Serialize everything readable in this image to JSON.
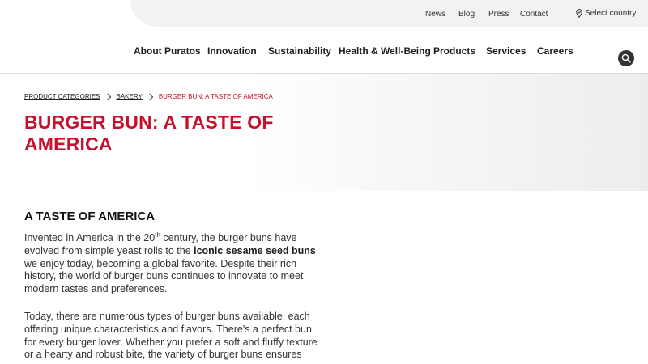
{
  "utility_nav": {
    "news": "News",
    "blog": "Blog",
    "press": "Press",
    "contact": "Contact",
    "country": "Select country",
    "country_icon": "location-pin-icon"
  },
  "main_nav": {
    "items": [
      "About Puratos",
      "Innovation",
      "Sustainability",
      "Health & Well-Being",
      "Products",
      "Services",
      "Careers"
    ],
    "search_icon": "search-icon"
  },
  "breadcrumb": {
    "items": [
      "PRODUCT CATEGORIES",
      "BAKERY"
    ],
    "current": "BURGER BUN: A TASTE OF AMERICA"
  },
  "page": {
    "title": "BURGER BUN: A TASTE OF AMERICA"
  },
  "content": {
    "section_title": "A TASTE OF AMERICA",
    "p1_a": "Invented in America in the 20",
    "p1_sup": "th",
    "p1_b": " century, the burger buns have evolved from simple yeast rolls to the ",
    "p1_bold": "iconic sesame seed buns",
    "p1_c": " we enjoy today, becoming a global favorite. Despite their rich history, the world of burger buns continues to innovate to meet modern tastes and preferences.",
    "p2": "Today, there are numerous types of burger buns available, each offering unique characteristics and flavors. There's a perfect bun for every burger lover. Whether you prefer a soft and fluffy texture or a hearty and robust bite, the variety of burger buns ensures"
  },
  "colors": {
    "brand_red": "#c8102e",
    "utility_bg": "#f2f2f2",
    "search_bg": "#333333"
  }
}
